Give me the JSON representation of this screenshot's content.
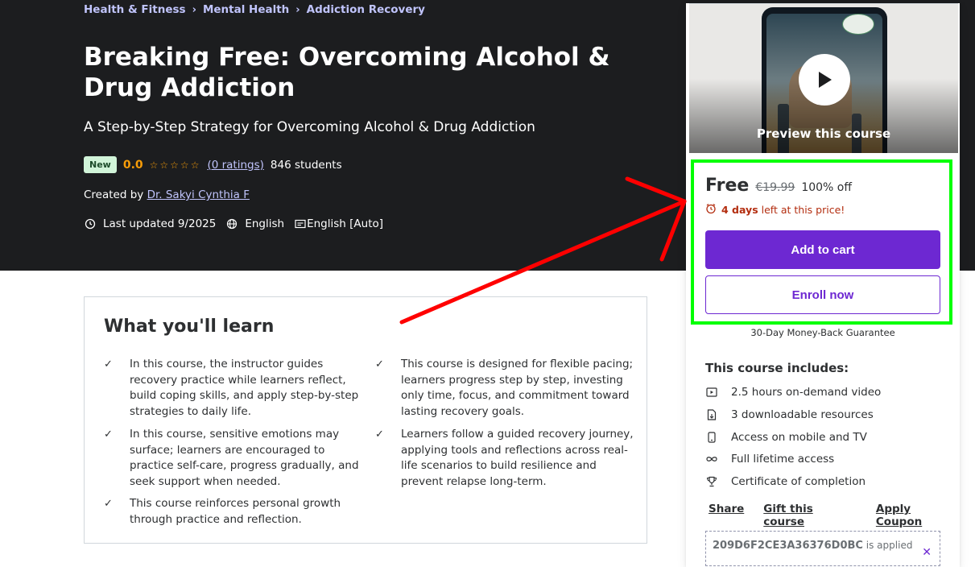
{
  "breadcrumb": [
    "Health & Fitness",
    "Mental Health",
    "Addiction Recovery"
  ],
  "course": {
    "title": "Breaking Free: Overcoming Alcohol & Drug Addiction",
    "subtitle": "A Step-by-Step Strategy for Overcoming Alcohol & Drug Addiction",
    "badge": "New",
    "rating": "0.0",
    "stars": "☆☆☆☆☆",
    "ratings_text": "(0 ratings)",
    "students": "846 students",
    "created_by_label": "Created by",
    "instructor": "Dr. Sakyi Cynthia F",
    "last_updated": "Last updated 9/2025",
    "language": "English",
    "captions": "English [Auto]"
  },
  "learn": {
    "title": "What you'll learn",
    "items": [
      "In this course, the instructor guides recovery practice while learners reflect, build coping skills, and apply step-by-step strategies to daily life.",
      "This course is designed for flexible pacing; learners progress step by step, investing only time, focus, and commitment toward lasting recovery goals.",
      "In this course, sensitive emotions may surface; learners are encouraged to practice self-care, progress gradually, and seek support when needed.",
      "Learners follow a guided recovery journey, applying tools and reflections across real-life scenarios to build resilience and prevent relapse long-term.",
      "This course reinforces personal growth through practice and reflection."
    ],
    "check": "✓"
  },
  "card": {
    "preview_label": "Preview this course",
    "price": "Free",
    "original_price": "€19.99",
    "discount": "100% off",
    "timer_bold": "4 days",
    "timer_rest": " left at this price!",
    "add_to_cart": "Add to cart",
    "enroll_now": "Enroll now",
    "guarantee": "30-Day Money-Back Guarantee",
    "includes_title": "This course includes:",
    "includes": [
      {
        "icon": "video-icon",
        "text": "2.5 hours on-demand video"
      },
      {
        "icon": "download-file-icon",
        "text": "3 downloadable resources"
      },
      {
        "icon": "mobile-icon",
        "text": "Access on mobile and TV"
      },
      {
        "icon": "infinity-icon",
        "text": "Full lifetime access"
      },
      {
        "icon": "trophy-icon",
        "text": "Certificate of completion"
      }
    ],
    "share": "Share",
    "gift": "Gift this course",
    "apply_coupon": "Apply Coupon",
    "coupon_code": "209D6F2CE3A36376D0BC",
    "coupon_status": "is applied"
  },
  "annotations": {
    "highlight_color": "#00ff00",
    "arrow_color": "#ff0000"
  },
  "colors": {
    "hero_bg": "#1c1d1f",
    "accent": "#6d28d2",
    "link": "#c0c4fc",
    "rating": "#f69c08",
    "urgent": "#b32d0f"
  }
}
